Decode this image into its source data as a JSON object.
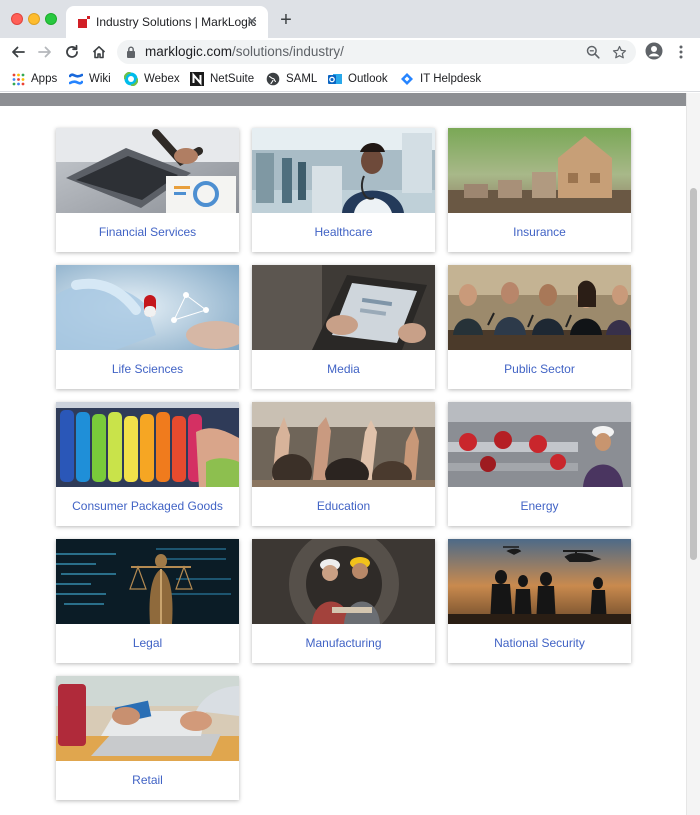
{
  "browser": {
    "tab_title": "Industry Solutions | MarkLogic",
    "url_domain": "marklogic.com",
    "url_path": "/solutions/industry/",
    "bookmarks": [
      "Apps",
      "Wiki",
      "Webex",
      "NetSuite",
      "SAML",
      "Outlook",
      "IT Helpdesk"
    ]
  },
  "industries": [
    {
      "label": "Financial Services",
      "image": "laptop-and-charts-photo"
    },
    {
      "label": "Healthcare",
      "image": "doctor-with-stethoscope-photo"
    },
    {
      "label": "Insurance",
      "image": "coin-stacks-and-wooden-house-photo"
    },
    {
      "label": "Life Sciences",
      "image": "gloved-hand-holding-capsule-photo"
    },
    {
      "label": "Media",
      "image": "hands-holding-tablet-photo"
    },
    {
      "label": "Public Sector",
      "image": "panel-of-officials-with-microphones-photo"
    },
    {
      "label": "Consumer Packaged Goods",
      "image": "supermarket-shelf-bottles-photo"
    },
    {
      "label": "Education",
      "image": "students-raising-hands-photo"
    },
    {
      "label": "Energy",
      "image": "engineer-at-pipeline-valves-photo"
    },
    {
      "label": "Legal",
      "image": "lady-justice-statue-photo"
    },
    {
      "label": "Manufacturing",
      "image": "workers-in-hard-hats-photo"
    },
    {
      "label": "National Security",
      "image": "soldiers-and-helicopters-silhouette-photo"
    },
    {
      "label": "Retail",
      "image": "hands-with-credit-card-and-laptop-photo"
    }
  ],
  "colors": {
    "link": "#4163c5",
    "banner": "#8d8f93"
  }
}
